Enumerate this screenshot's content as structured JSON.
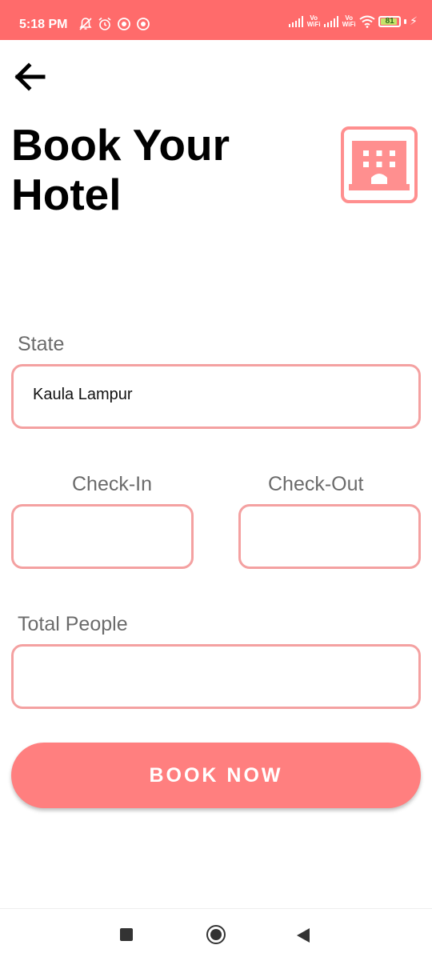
{
  "status_bar": {
    "time": "5:18 PM",
    "battery_level": "81",
    "left_icons": [
      "bell-off-icon",
      "alarm-icon",
      "circle-app-icon",
      "circle-app-icon"
    ],
    "right_icons": [
      "signal-icon",
      "vowifi-icon",
      "signal-icon",
      "vowifi-icon",
      "wifi-icon",
      "battery-icon",
      "charging-icon"
    ],
    "vowifi_label": "Vo WiFi"
  },
  "header": {
    "back_icon": "arrow-left-icon",
    "title": "Book Your Hotel",
    "hotel_icon": "hotel-icon"
  },
  "form": {
    "state_label": "State",
    "state_value": "Kaula Lampur",
    "checkin_label": "Check-In",
    "checkin_value": "",
    "checkout_label": "Check-Out",
    "checkout_value": "",
    "people_label": "Total People",
    "people_value": ""
  },
  "actions": {
    "book_label": "BOOK NOW"
  },
  "colors": {
    "accent": "#ff6b6b",
    "button": "#ff7f7f",
    "field_border": "#f4a1a1",
    "icon": "#ff8f8f"
  },
  "nav_bar": {
    "icons": [
      "recents-icon",
      "home-icon",
      "back-icon"
    ]
  }
}
